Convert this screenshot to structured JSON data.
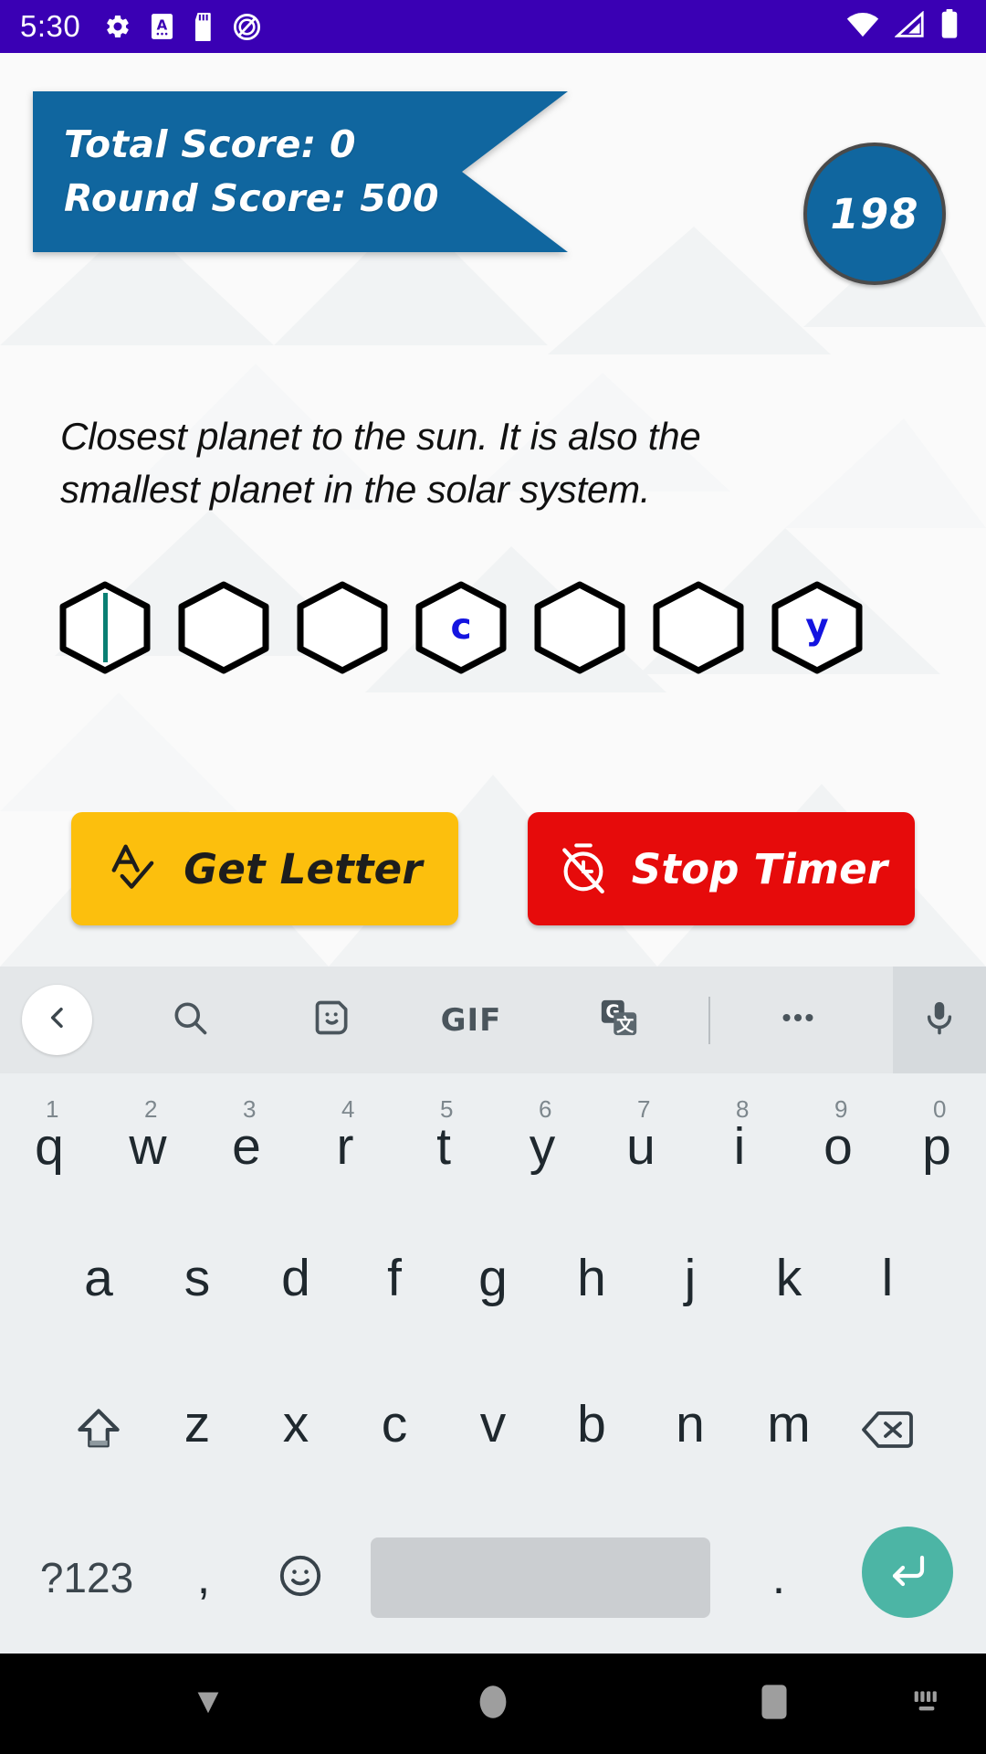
{
  "status_bar": {
    "time": "5:30",
    "left_icons": [
      "gear-icon",
      "android-auto-icon",
      "sd-card-icon",
      "do-not-disturb-icon"
    ],
    "right_icons": [
      "wifi-icon",
      "cellular-signal-icon",
      "battery-icon"
    ],
    "background_color": "#3a00b4"
  },
  "game": {
    "ribbon": {
      "total_score_label": "Total Score: 0",
      "round_score_label": "Round Score: 500",
      "color": "#10669f"
    },
    "timer": {
      "value": "198",
      "color": "#10669f",
      "border_color": "#4a4a4a"
    },
    "clue": "Closest planet to the sun. It is also the smallest planet in the solar system.",
    "letters": [
      {
        "char": "",
        "cursor": true
      },
      {
        "char": "",
        "cursor": false
      },
      {
        "char": "",
        "cursor": false
      },
      {
        "char": "c",
        "cursor": false
      },
      {
        "char": "",
        "cursor": false
      },
      {
        "char": "",
        "cursor": false
      },
      {
        "char": "y",
        "cursor": false
      }
    ],
    "letter_color": "#1414e0",
    "cursor_color": "#0a7f73",
    "buttons": {
      "get_letter": {
        "label": "Get Letter",
        "icon": "a-checkmark-icon",
        "color": "#fcbf0d",
        "text_color": "#1d1d1d"
      },
      "stop_timer": {
        "label": "Stop Timer",
        "icon": "timer-off-icon",
        "color": "#e60b0b",
        "text_color": "#ffffff"
      }
    }
  },
  "keyboard": {
    "toolbar": {
      "back": "chevron-left-icon",
      "tools": [
        "search-icon",
        "sticker-icon",
        "gif-icon",
        "translate-icon"
      ],
      "gif_label": "GIF",
      "more": "more-horizontal-icon",
      "mic": "microphone-icon"
    },
    "row1": [
      {
        "key": "q",
        "num": "1"
      },
      {
        "key": "w",
        "num": "2"
      },
      {
        "key": "e",
        "num": "3"
      },
      {
        "key": "r",
        "num": "4"
      },
      {
        "key": "t",
        "num": "5"
      },
      {
        "key": "y",
        "num": "6"
      },
      {
        "key": "u",
        "num": "7"
      },
      {
        "key": "i",
        "num": "8"
      },
      {
        "key": "o",
        "num": "9"
      },
      {
        "key": "p",
        "num": "0"
      }
    ],
    "row2": [
      "a",
      "s",
      "d",
      "f",
      "g",
      "h",
      "j",
      "k",
      "l"
    ],
    "row3": [
      "z",
      "x",
      "c",
      "v",
      "b",
      "n",
      "m"
    ],
    "row3_shift_icon": "shift-icon",
    "row3_backspace_icon": "backspace-icon",
    "row4": {
      "symbols_label": "?123",
      "comma": ",",
      "emoji_icon": "emoji-icon",
      "space": "",
      "period": ".",
      "enter_icon": "enter-icon",
      "enter_color": "#4cb5a5"
    }
  },
  "nav_bar": {
    "back": "back-triangle-icon",
    "home": "home-circle-icon",
    "recents": "recents-square-icon",
    "keyboard": "keyboard-indicator-icon"
  }
}
